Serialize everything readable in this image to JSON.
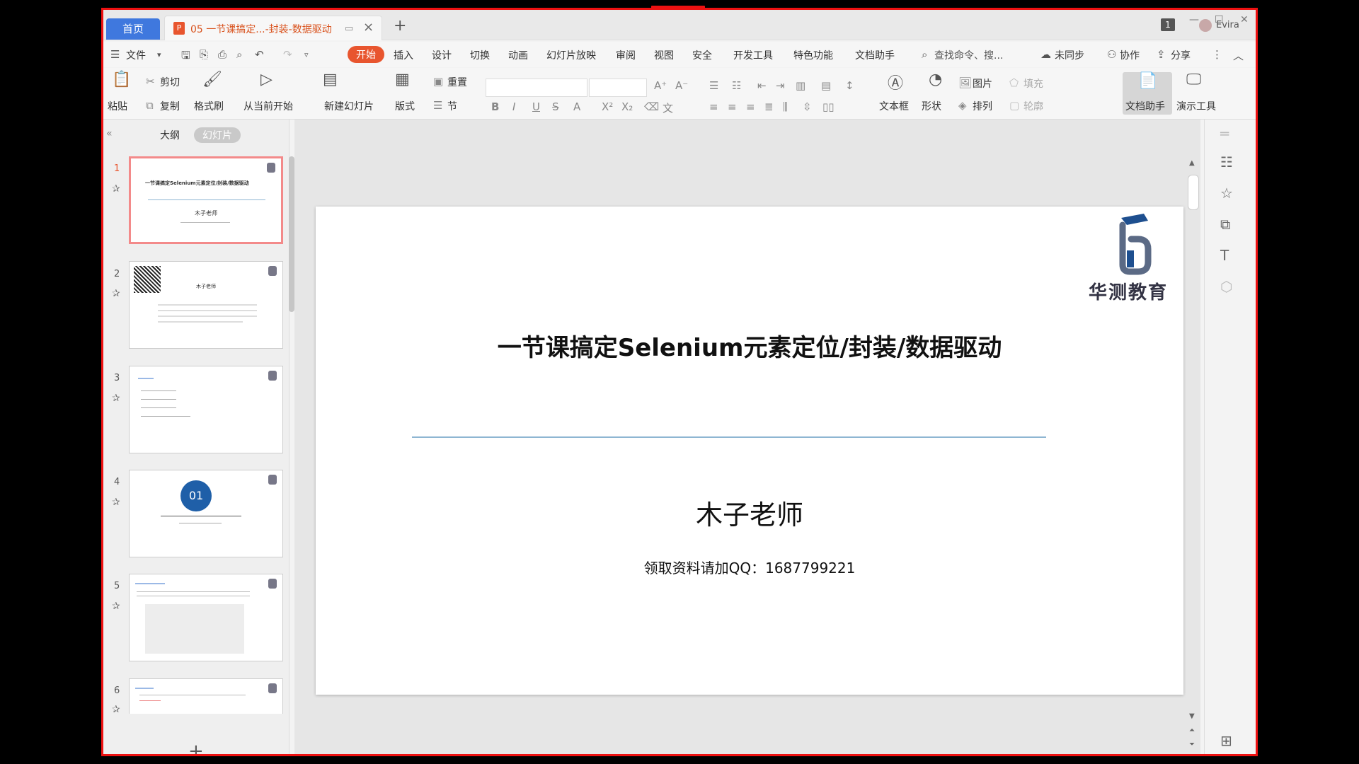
{
  "tabs": {
    "home": "首页",
    "document": "05 一节课搞定...-封装-数据驱动",
    "add": "+"
  },
  "titlebar": {
    "badge": "1",
    "user": "Evira"
  },
  "menu": {
    "file": "文件",
    "items": [
      "开始",
      "插入",
      "设计",
      "切换",
      "动画",
      "幻灯片放映",
      "审阅",
      "视图",
      "安全",
      "开发工具",
      "特色功能",
      "文档助手"
    ],
    "search": "查找命令、搜...",
    "sync": "未同步",
    "collab": "协作",
    "share": "分享"
  },
  "ribbon": {
    "paste": "粘贴",
    "cut": "剪切",
    "copy": "复制",
    "format_painter": "格式刷",
    "from_current": "从当前开始",
    "new_slide": "新建幻灯片",
    "layout": "版式",
    "reset": "重置",
    "section": "节",
    "textbox": "文本框",
    "shape": "形状",
    "picture": "图片",
    "fill": "填充",
    "arrange": "排列",
    "outline": "轮廓",
    "doc_assistant": "文档助手",
    "present_tool": "演示工具"
  },
  "leftpane": {
    "tab_outline": "大纲",
    "tab_slides": "幻灯片",
    "thumbs": [
      {
        "num": "1",
        "text": "一节课搞定Selenium元素定位/封装/数据驱动",
        "sub": "木子老师"
      },
      {
        "num": "2",
        "text": "木子老师",
        "sub": ""
      },
      {
        "num": "3",
        "text": "",
        "sub": ""
      },
      {
        "num": "4",
        "text": "01",
        "sub": ""
      },
      {
        "num": "5",
        "text": "",
        "sub": ""
      },
      {
        "num": "6",
        "text": "",
        "sub": ""
      }
    ]
  },
  "slide": {
    "title": "一节课搞定Selenium元素定位/封装/数据驱动",
    "author": "木子老师",
    "contact": "领取资料请加QQ：1687799221",
    "logo_text": "华测教育"
  },
  "colors": {
    "accent": "#e8552e",
    "home_tab": "#3f78de",
    "border": "#ee1111",
    "rule": "#8eb6d2"
  }
}
